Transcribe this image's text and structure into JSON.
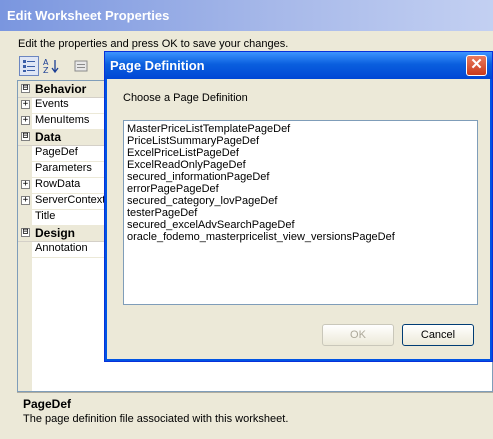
{
  "window": {
    "title": "Edit Worksheet Properties"
  },
  "instruction": "Edit the properties and press OK to save your changes.",
  "toolbar": {
    "categorized_icon": "categorized-icon",
    "alphabetical_icon": "sort-az-icon",
    "property_pages_icon": "property-pages-icon"
  },
  "property_grid": [
    {
      "kind": "category",
      "label": "Behavior",
      "expander": "⊟"
    },
    {
      "kind": "item",
      "label": "Events",
      "expander": "+"
    },
    {
      "kind": "item",
      "label": "MenuItems",
      "expander": "+"
    },
    {
      "kind": "category",
      "label": "Data",
      "expander": "⊟"
    },
    {
      "kind": "item",
      "label": "PageDef",
      "expander": ""
    },
    {
      "kind": "item",
      "label": "Parameters",
      "expander": ""
    },
    {
      "kind": "item",
      "label": "RowData",
      "expander": "+"
    },
    {
      "kind": "item",
      "label": "ServerContext",
      "expander": "+"
    },
    {
      "kind": "item",
      "label": "Title",
      "expander": ""
    },
    {
      "kind": "category",
      "label": "Design",
      "expander": "⊟"
    },
    {
      "kind": "item",
      "label": "Annotation",
      "expander": ""
    }
  ],
  "description": {
    "title": "PageDef",
    "text": "The page definition file associated with this worksheet."
  },
  "dialog": {
    "title": "Page Definition",
    "close_glyph": "✕",
    "prompt": "Choose a Page Definition",
    "items": [
      "MasterPriceListTemplatePageDef",
      "PriceListSummaryPageDef",
      "ExcelPriceListPageDef",
      "ExcelReadOnlyPageDef",
      "secured_informationPageDef",
      "errorPagePageDef",
      "secured_category_lovPageDef",
      "testerPageDef",
      "secured_excelAdvSearchPageDef",
      "oracle_fodemo_masterpricelist_view_versionsPageDef"
    ],
    "ok_label": "OK",
    "cancel_label": "Cancel"
  },
  "colors": {
    "dialog_title": "#0054e3",
    "outer_title_inactive": "#7a96df",
    "surface": "#ece9d8"
  }
}
